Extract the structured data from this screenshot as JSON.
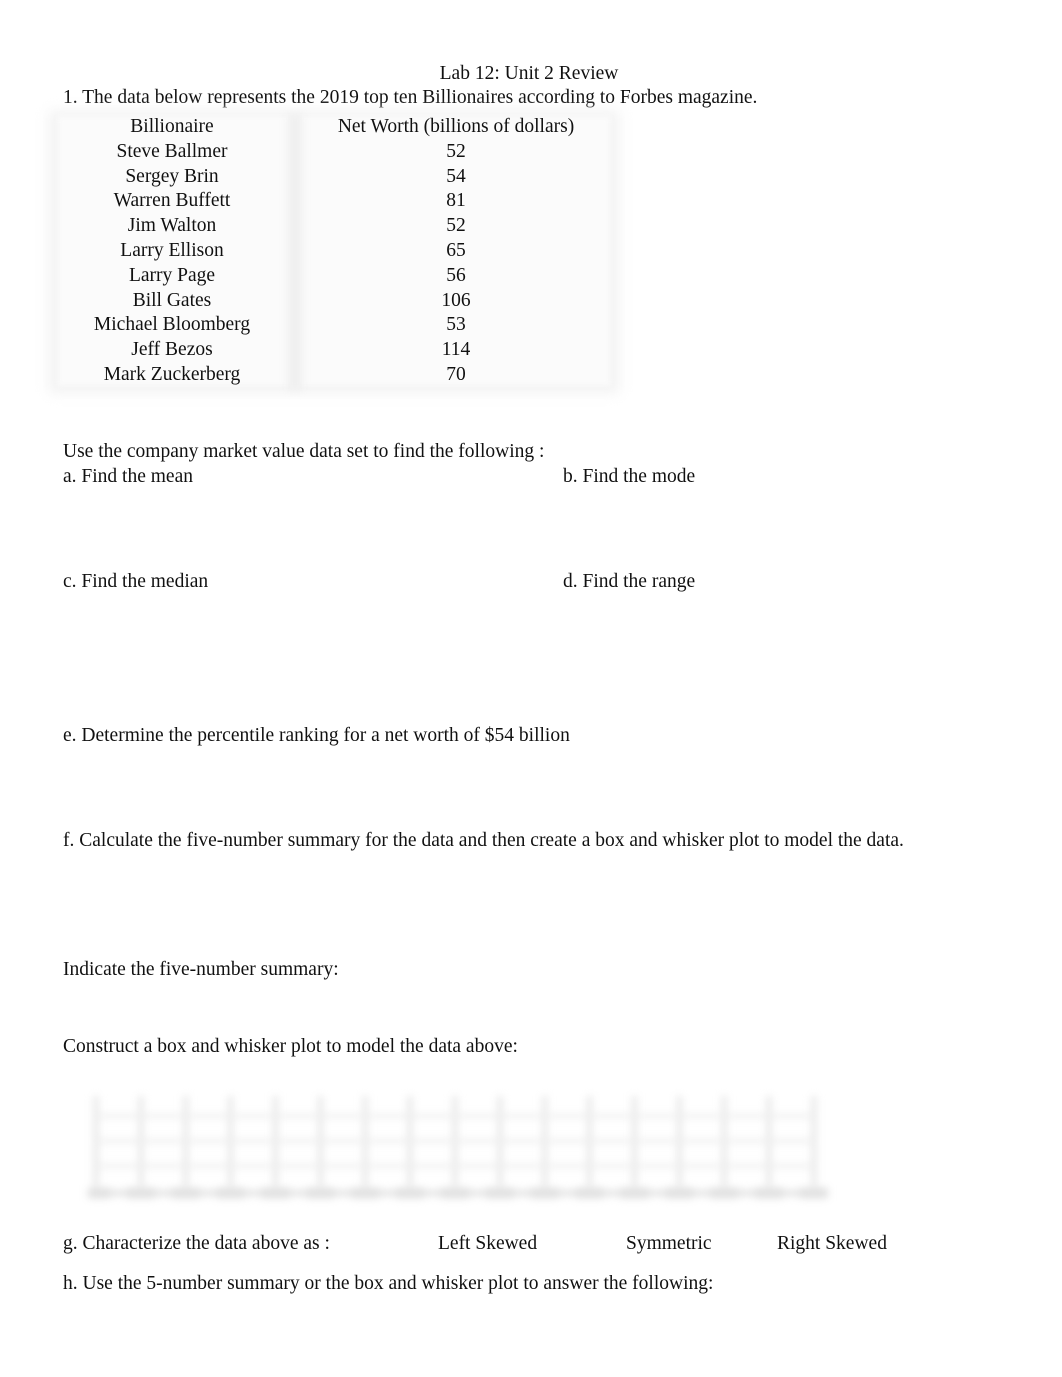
{
  "document": {
    "title": "Lab 12: Unit 2 Review",
    "question_1": "1.  The data below represents the 2019 top ten Billionaires according to Forbes magazine.",
    "table": {
      "headers": [
        "Billionaire",
        "Net Worth (billions of dollars)"
      ],
      "rows": [
        {
          "name": "Steve Ballmer",
          "net_worth": "52"
        },
        {
          "name": "Sergey Brin",
          "net_worth": "54"
        },
        {
          "name": "Warren Buffett",
          "net_worth": "81"
        },
        {
          "name": "Jim Walton",
          "net_worth": "52"
        },
        {
          "name": "Larry Ellison",
          "net_worth": "65"
        },
        {
          "name": "Larry Page",
          "net_worth": "56"
        },
        {
          "name": "Bill Gates",
          "net_worth": "106"
        },
        {
          "name": "Michael Bloomberg",
          "net_worth": "53"
        },
        {
          "name": "Jeff Bezos",
          "net_worth": "114"
        },
        {
          "name": "Mark Zuckerberg",
          "net_worth": "70"
        }
      ]
    },
    "intro": "Use the company market value data set to find the following     :",
    "part_a": "a.  Find the mean",
    "part_b": "b.  Find the mode",
    "part_c": "c.  Find the median",
    "part_d": "d.  Find the range",
    "part_e": "e.  Determine the percentile ranking for a net worth of $54 billion",
    "part_f": "f.  Calculate the five-number summary for the data and then create a box and whisker plot to model the data.",
    "five_number_prompt": "Indicate the five-number summary:",
    "construct_prompt": "Construct a box and whisker plot to model the data above:",
    "part_g": "g.  Characterize the data above as    :",
    "skew_options": [
      "Left Skewed",
      "Symmetric",
      "Right Skewed"
    ],
    "part_h": "h.  Use the 5-number summary or the box and whisker plot to answer the following:"
  }
}
